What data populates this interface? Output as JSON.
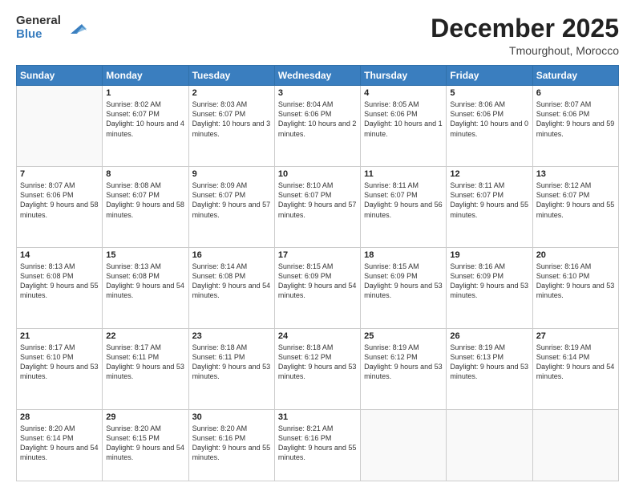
{
  "logo": {
    "general": "General",
    "blue": "Blue"
  },
  "header": {
    "month": "December 2025",
    "location": "Tmourghout, Morocco"
  },
  "days_of_week": [
    "Sunday",
    "Monday",
    "Tuesday",
    "Wednesday",
    "Thursday",
    "Friday",
    "Saturday"
  ],
  "weeks": [
    [
      {
        "day": "",
        "sunrise": "",
        "sunset": "",
        "daylight": ""
      },
      {
        "day": "1",
        "sunrise": "Sunrise: 8:02 AM",
        "sunset": "Sunset: 6:07 PM",
        "daylight": "Daylight: 10 hours and 4 minutes."
      },
      {
        "day": "2",
        "sunrise": "Sunrise: 8:03 AM",
        "sunset": "Sunset: 6:07 PM",
        "daylight": "Daylight: 10 hours and 3 minutes."
      },
      {
        "day": "3",
        "sunrise": "Sunrise: 8:04 AM",
        "sunset": "Sunset: 6:06 PM",
        "daylight": "Daylight: 10 hours and 2 minutes."
      },
      {
        "day": "4",
        "sunrise": "Sunrise: 8:05 AM",
        "sunset": "Sunset: 6:06 PM",
        "daylight": "Daylight: 10 hours and 1 minute."
      },
      {
        "day": "5",
        "sunrise": "Sunrise: 8:06 AM",
        "sunset": "Sunset: 6:06 PM",
        "daylight": "Daylight: 10 hours and 0 minutes."
      },
      {
        "day": "6",
        "sunrise": "Sunrise: 8:07 AM",
        "sunset": "Sunset: 6:06 PM",
        "daylight": "Daylight: 9 hours and 59 minutes."
      }
    ],
    [
      {
        "day": "7",
        "sunrise": "Sunrise: 8:07 AM",
        "sunset": "Sunset: 6:06 PM",
        "daylight": "Daylight: 9 hours and 58 minutes."
      },
      {
        "day": "8",
        "sunrise": "Sunrise: 8:08 AM",
        "sunset": "Sunset: 6:07 PM",
        "daylight": "Daylight: 9 hours and 58 minutes."
      },
      {
        "day": "9",
        "sunrise": "Sunrise: 8:09 AM",
        "sunset": "Sunset: 6:07 PM",
        "daylight": "Daylight: 9 hours and 57 minutes."
      },
      {
        "day": "10",
        "sunrise": "Sunrise: 8:10 AM",
        "sunset": "Sunset: 6:07 PM",
        "daylight": "Daylight: 9 hours and 57 minutes."
      },
      {
        "day": "11",
        "sunrise": "Sunrise: 8:11 AM",
        "sunset": "Sunset: 6:07 PM",
        "daylight": "Daylight: 9 hours and 56 minutes."
      },
      {
        "day": "12",
        "sunrise": "Sunrise: 8:11 AM",
        "sunset": "Sunset: 6:07 PM",
        "daylight": "Daylight: 9 hours and 55 minutes."
      },
      {
        "day": "13",
        "sunrise": "Sunrise: 8:12 AM",
        "sunset": "Sunset: 6:07 PM",
        "daylight": "Daylight: 9 hours and 55 minutes."
      }
    ],
    [
      {
        "day": "14",
        "sunrise": "Sunrise: 8:13 AM",
        "sunset": "Sunset: 6:08 PM",
        "daylight": "Daylight: 9 hours and 55 minutes."
      },
      {
        "day": "15",
        "sunrise": "Sunrise: 8:13 AM",
        "sunset": "Sunset: 6:08 PM",
        "daylight": "Daylight: 9 hours and 54 minutes."
      },
      {
        "day": "16",
        "sunrise": "Sunrise: 8:14 AM",
        "sunset": "Sunset: 6:08 PM",
        "daylight": "Daylight: 9 hours and 54 minutes."
      },
      {
        "day": "17",
        "sunrise": "Sunrise: 8:15 AM",
        "sunset": "Sunset: 6:09 PM",
        "daylight": "Daylight: 9 hours and 54 minutes."
      },
      {
        "day": "18",
        "sunrise": "Sunrise: 8:15 AM",
        "sunset": "Sunset: 6:09 PM",
        "daylight": "Daylight: 9 hours and 53 minutes."
      },
      {
        "day": "19",
        "sunrise": "Sunrise: 8:16 AM",
        "sunset": "Sunset: 6:09 PM",
        "daylight": "Daylight: 9 hours and 53 minutes."
      },
      {
        "day": "20",
        "sunrise": "Sunrise: 8:16 AM",
        "sunset": "Sunset: 6:10 PM",
        "daylight": "Daylight: 9 hours and 53 minutes."
      }
    ],
    [
      {
        "day": "21",
        "sunrise": "Sunrise: 8:17 AM",
        "sunset": "Sunset: 6:10 PM",
        "daylight": "Daylight: 9 hours and 53 minutes."
      },
      {
        "day": "22",
        "sunrise": "Sunrise: 8:17 AM",
        "sunset": "Sunset: 6:11 PM",
        "daylight": "Daylight: 9 hours and 53 minutes."
      },
      {
        "day": "23",
        "sunrise": "Sunrise: 8:18 AM",
        "sunset": "Sunset: 6:11 PM",
        "daylight": "Daylight: 9 hours and 53 minutes."
      },
      {
        "day": "24",
        "sunrise": "Sunrise: 8:18 AM",
        "sunset": "Sunset: 6:12 PM",
        "daylight": "Daylight: 9 hours and 53 minutes."
      },
      {
        "day": "25",
        "sunrise": "Sunrise: 8:19 AM",
        "sunset": "Sunset: 6:12 PM",
        "daylight": "Daylight: 9 hours and 53 minutes."
      },
      {
        "day": "26",
        "sunrise": "Sunrise: 8:19 AM",
        "sunset": "Sunset: 6:13 PM",
        "daylight": "Daylight: 9 hours and 53 minutes."
      },
      {
        "day": "27",
        "sunrise": "Sunrise: 8:19 AM",
        "sunset": "Sunset: 6:14 PM",
        "daylight": "Daylight: 9 hours and 54 minutes."
      }
    ],
    [
      {
        "day": "28",
        "sunrise": "Sunrise: 8:20 AM",
        "sunset": "Sunset: 6:14 PM",
        "daylight": "Daylight: 9 hours and 54 minutes."
      },
      {
        "day": "29",
        "sunrise": "Sunrise: 8:20 AM",
        "sunset": "Sunset: 6:15 PM",
        "daylight": "Daylight: 9 hours and 54 minutes."
      },
      {
        "day": "30",
        "sunrise": "Sunrise: 8:20 AM",
        "sunset": "Sunset: 6:16 PM",
        "daylight": "Daylight: 9 hours and 55 minutes."
      },
      {
        "day": "31",
        "sunrise": "Sunrise: 8:21 AM",
        "sunset": "Sunset: 6:16 PM",
        "daylight": "Daylight: 9 hours and 55 minutes."
      },
      {
        "day": "",
        "sunrise": "",
        "sunset": "",
        "daylight": ""
      },
      {
        "day": "",
        "sunrise": "",
        "sunset": "",
        "daylight": ""
      },
      {
        "day": "",
        "sunrise": "",
        "sunset": "",
        "daylight": ""
      }
    ]
  ]
}
